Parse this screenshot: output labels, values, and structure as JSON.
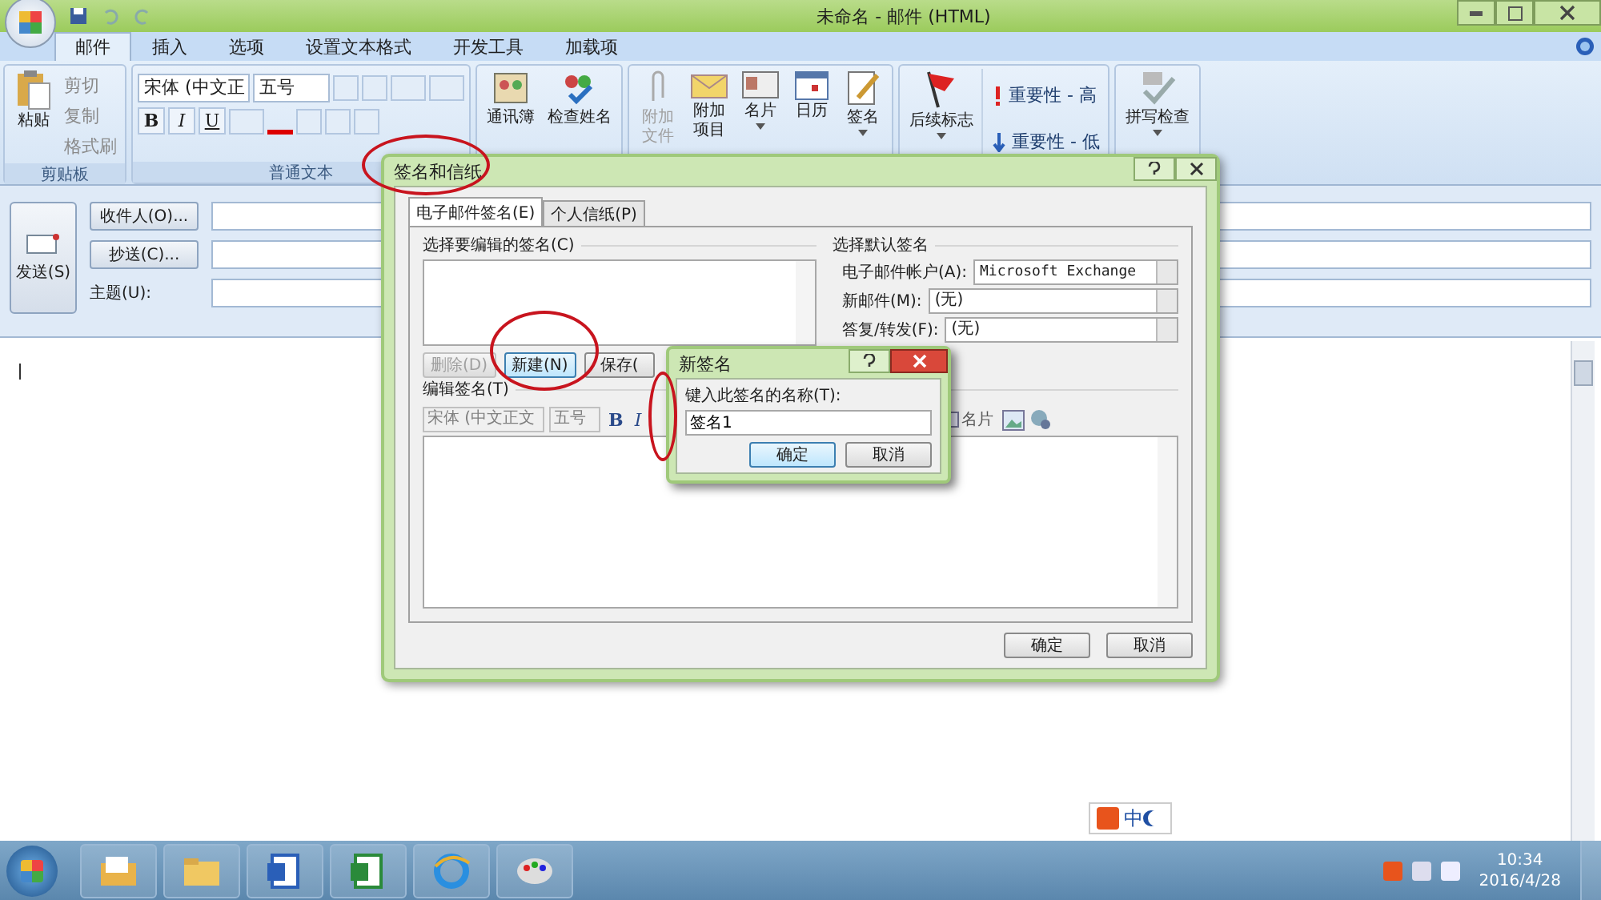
{
  "window": {
    "title": "未命名 - 邮件 (HTML)"
  },
  "ribbon_tabs": [
    {
      "label": "邮件",
      "selected": true
    },
    {
      "label": "插入",
      "selected": false
    },
    {
      "label": "选项",
      "selected": false
    },
    {
      "label": "设置文本格式",
      "selected": false
    },
    {
      "label": "开发工具",
      "selected": false
    },
    {
      "label": "加载项",
      "selected": false
    }
  ],
  "ribbon": {
    "clipboard": {
      "label": "剪贴板",
      "paste": "粘贴",
      "small": [
        "剪切",
        "复制",
        "格式刷"
      ]
    },
    "text": {
      "label": "普通文本",
      "font": "宋体 (中文正",
      "size": "五号",
      "bold": "B",
      "italic": "I",
      "underline": "U"
    },
    "names": [
      {
        "label": "通讯簿",
        "kind": "book"
      },
      {
        "label": "检查姓名",
        "kind": "people"
      }
    ],
    "include": [
      {
        "label": "附加文件",
        "kind": "clip",
        "disabled": true,
        "dropdown": false
      },
      {
        "label": "附加项目",
        "kind": "envelope",
        "disabled": false,
        "dropdown": false
      },
      {
        "label": "名片",
        "kind": "card",
        "disabled": false,
        "dropdown": true
      },
      {
        "label": "日历",
        "kind": "calendar",
        "disabled": false,
        "dropdown": false
      },
      {
        "label": "签名",
        "kind": "pen",
        "disabled": false,
        "dropdown": true
      }
    ],
    "options": {
      "flag": "后续标志",
      "high": "重要性 - 高",
      "low": "重要性 - 低"
    },
    "proofing": {
      "spell": "拼写检查"
    }
  },
  "compose": {
    "send": "发送(S)",
    "to": "收件人(O)...",
    "cc": "抄送(C)...",
    "subject": "主题(U):"
  },
  "signature_dialog": {
    "title": "签名和信纸",
    "tabs": [
      {
        "label": "电子邮件签名(E)",
        "selected": true
      },
      {
        "label": "个人信纸(P)",
        "selected": false
      }
    ],
    "list_label": "选择要编辑的签名(C)",
    "buttons": [
      {
        "label": "删除(D)",
        "disabled": true
      },
      {
        "label": "新建(N)",
        "disabled": false
      },
      {
        "label": "保存(",
        "disabled": false
      }
    ],
    "defaults_heading": "选择默认签名",
    "defaults": [
      {
        "label": "电子邮件帐户(A):",
        "value": "Microsoft Exchange"
      },
      {
        "label": "新邮件(M):",
        "value": "(无)"
      },
      {
        "label": "答复/转发(F):",
        "value": "(无)"
      }
    ],
    "edit_label": "编辑签名(T)",
    "toolbar": {
      "font": "宋体 (中文正文",
      "size": "五号",
      "bold": "B",
      "italic": "I",
      "card": "名片"
    },
    "ok": "确定",
    "cancel": "取消"
  },
  "new_signature_dialog": {
    "title": "新签名",
    "prompt": "键入此签名的名称(T):",
    "value": "签名1",
    "ok": "确定",
    "cancel": "取消"
  },
  "taskbar": {
    "ime": "中",
    "time": "10:34",
    "date": "2016/4/28"
  }
}
